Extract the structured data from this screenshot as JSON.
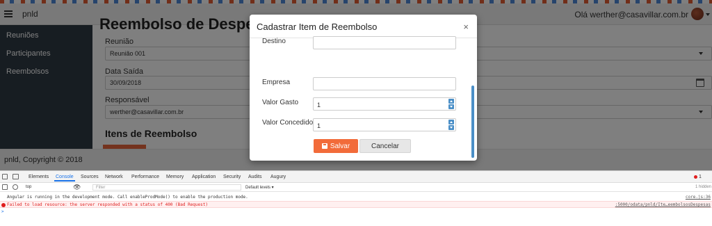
{
  "navbar": {
    "brand": "pnld",
    "user_greeting": "Olá werther@casavillar.com.br"
  },
  "sidebar": {
    "items": [
      {
        "label": "Reuniões"
      },
      {
        "label": "Participantes"
      },
      {
        "label": "Reembolsos"
      }
    ]
  },
  "main": {
    "title": "Reembolso de Despesa",
    "fields": [
      {
        "label": "Reunião",
        "value": "Reunião 001"
      },
      {
        "label": "Data Saída",
        "value": "30/09/2018"
      },
      {
        "label": "Responsável",
        "value": "werther@casavillar.com.br"
      }
    ],
    "section_title": "Itens de Reembolso"
  },
  "footer": {
    "text": "pnld, Copyright © 2018"
  },
  "modal": {
    "title": "Cadastrar Item de Reembolso",
    "close_glyph": "×",
    "fields": [
      {
        "label": "Destino",
        "value": ""
      },
      {
        "label": "Empresa",
        "value": ""
      },
      {
        "label": "Valor Gasto",
        "value": "1"
      },
      {
        "label": "Valor Concedido",
        "value": "1"
      }
    ],
    "save_label": "Salvar",
    "cancel_label": "Cancelar"
  },
  "devtools": {
    "tabs": [
      "Elements",
      "Console",
      "Sources",
      "Network",
      "Performance",
      "Memory",
      "Application",
      "Security",
      "Audits",
      "Augury"
    ],
    "active_tab": "Console",
    "error_count": "1",
    "context": "top",
    "filter_placeholder": "Filter",
    "levels": "Default levels ▾",
    "hidden": "1 hidden",
    "logs": [
      {
        "type": "info",
        "message": "Angular is running in the development mode. Call enableProdMode() to enable the production mode.",
        "source": "core.js:36"
      },
      {
        "type": "error",
        "message": "Failed to load resource: the server responded with a status of 400 (Bad Request)",
        "source": ":5000/odata/pnld/Ite…eembolsosDespesas"
      }
    ],
    "prompt": ">"
  },
  "colors": {
    "sidebar_bg": "#2f3a45",
    "accent_orange": "#f26b3a",
    "spinner_blue": "#4b8fc7",
    "error_red": "#e01e1e"
  }
}
